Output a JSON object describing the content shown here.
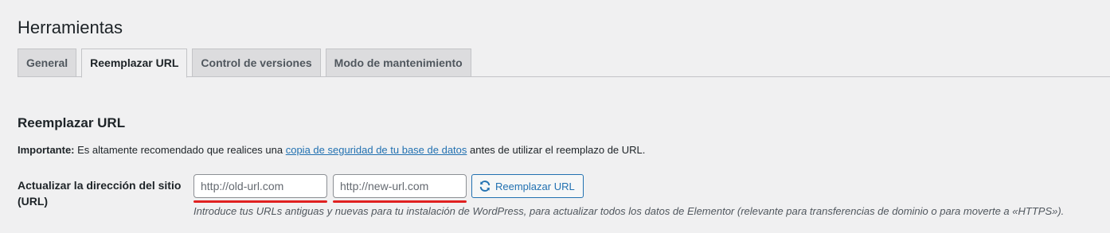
{
  "page": {
    "title": "Herramientas"
  },
  "tabs": [
    {
      "label": "General",
      "active": false
    },
    {
      "label": "Reemplazar URL",
      "active": true
    },
    {
      "label": "Control de versiones",
      "active": false
    },
    {
      "label": "Modo de mantenimiento",
      "active": false
    }
  ],
  "section": {
    "title": "Reemplazar URL",
    "notice": {
      "strong": "Importante:",
      "before_link": " Es altamente recomendado que realices una ",
      "link_text": "copia de seguridad de tu base de datos",
      "after_link": " antes de utilizar el reemplazo de URL."
    },
    "row": {
      "label": "Actualizar la dirección del sitio (URL)",
      "old_url": {
        "value": "",
        "placeholder": "http://old-url.com"
      },
      "new_url": {
        "value": "",
        "placeholder": "http://new-url.com"
      },
      "button_label": "Reemplazar URL",
      "button_icon": "refresh-icon",
      "description": "Introduce tus URLs antiguas y nuevas para tu instalación de WordPress, para actualizar todos los datos de Elementor (relevante para transferencias de dominio o para moverte a «HTTPS»)."
    }
  },
  "colors": {
    "background": "#f0f0f1",
    "link": "#2271b1",
    "annotation_underline": "#e02020"
  }
}
